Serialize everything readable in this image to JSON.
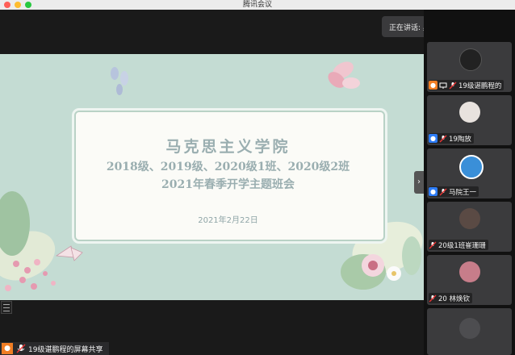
{
  "window": {
    "title": "腾讯会议"
  },
  "speaking": {
    "label": "正在讲话: 奥老师;"
  },
  "slide": {
    "title": "马克思主义学院",
    "line2": "2018级、2019级、2020级1班、2020级2班",
    "line3": "2021年春季开学主题班会",
    "date": "2021年2月22日"
  },
  "screenshare": {
    "label": "19级谌鹏程的屏幕共享"
  },
  "participants": [
    {
      "name": "19级谌鹏程的",
      "sharing": true
    },
    {
      "name": "19陶放",
      "sharing": false
    },
    {
      "name": "马院王一",
      "sharing": false
    },
    {
      "name": "20级1班崔珊珊",
      "sharing": false
    },
    {
      "name": "20 林焕钦",
      "sharing": false
    }
  ],
  "icons": {
    "expand": "chevron-right-icon",
    "mic": "mic-muted-icon",
    "screen": "screen-share-icon",
    "user": "user-icon"
  },
  "colors": {
    "accent": "#2d7cf6",
    "orange": "#f07d23",
    "slide_bg": "#c4dcd3",
    "title_text": "#9aaeb0"
  }
}
